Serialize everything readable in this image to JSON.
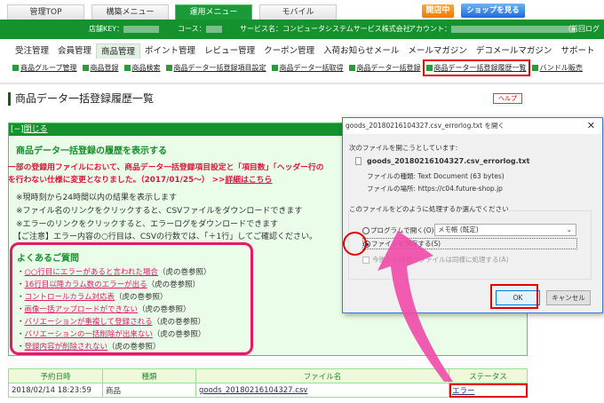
{
  "top_tabs": [
    "管理TOP",
    "構築メニュー",
    "運用メニュー",
    "モバイル"
  ],
  "active_tab": "運用メニュー",
  "open_button": "開店中",
  "shop_button": "ショップを見る",
  "info_bar": {
    "shop_key": "店舗KEY：",
    "course": "コース：",
    "service": "サービス名：コンピュータシステムサービス株式会社",
    "account": "アカウント：",
    "last_login": "（前回ログイン"
  },
  "menu": [
    "受注管理",
    "会員管理",
    "商品管理",
    "ポイント管理",
    "レビュー管理",
    "クーポン管理",
    "入荷お知らせメール",
    "メールマガジン",
    "デコメールマガジン",
    "サポート"
  ],
  "submenu": [
    "商品グループ管理",
    "商品登録",
    "商品検索",
    "商品データ一括登録項目設定",
    "商品データ一括取得",
    "商品データ一括登録",
    "商品データ一括登録履歴一覧",
    "バンドル販売"
  ],
  "page_title": "商品データ一括登録履歴一覧",
  "help": "ヘルプ",
  "panel": {
    "toggle_prefix": "[−]",
    "toggle": "閉じる",
    "heading": "商品データ一括登録の履歴を表示する",
    "warning1": "一部の登録用ファイルにおいて、商品データ一括登録項目設定と「項目数」「ヘッダー行の",
    "warning2": "を行わない仕様に変更となりました。（2017/01/25～） >>",
    "warning_link": "詳細はこちら",
    "notes": [
      "※現時刻から24時間以内の結果を表示します",
      "※ファイル名のリンクをクリックすると、CSVファイルをダウンロードできます",
      "※エラーのリンクをクリックすると、エラーログをダウンロードできます",
      "【ご注意】エラー内容の○行目は、CSVの行数では、「＋1行」してご確認ください。"
    ]
  },
  "faq": {
    "title": "よくあるご質問",
    "suffix": "（虎の巻参照）",
    "items": [
      "○○行目にエラーがあると言われた場合",
      "16行目以降カラム数のエラーが出る",
      "コントロールカラム対応表",
      "画像一括アップロードができない",
      "バリエーションが重複して登録される",
      "バリエーションの一括削除が出来ない",
      "登録内容が削除されない"
    ]
  },
  "table": {
    "headers": [
      "予約日時",
      "種類",
      "ファイル名",
      "ステータス"
    ],
    "rows": [
      [
        "2018/02/14 18:23:59",
        "商品",
        "goods_20180216104327.csv",
        "エラー"
      ]
    ]
  },
  "dialog": {
    "title": "goods_20180216104327.csv_errorlog.txt を開く",
    "intro": "次のファイルを開こうとしています:",
    "filename": "goods_20180216104327.csv_errorlog.txt",
    "type_label": "ファイルの種類:",
    "type_value": "Text Document (63 bytes)",
    "loc_label": "ファイルの場所:",
    "loc_value": "https://c04.future-shop.jp",
    "question": "このファイルをどのように処理するか選んでください",
    "open_with": "プログラムで開く(O):",
    "program": "メモ帳 (既定)",
    "save": "ファイルを保存する(S)",
    "remember": "今後この種類のファイルは同様に処理する(A)",
    "ok": "OK",
    "cancel": "キャンセル"
  },
  "colors": {
    "green": "#15912e",
    "highlight": "#e00000",
    "pink": "#e4196b"
  }
}
